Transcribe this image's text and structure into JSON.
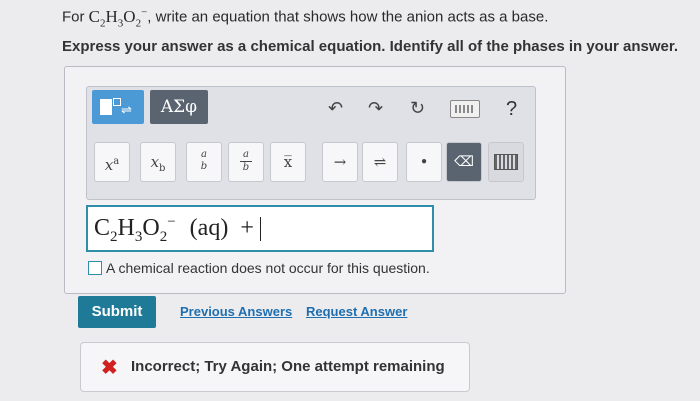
{
  "question": {
    "prefix": "For",
    "formula": {
      "c": "C",
      "c_sub": "2",
      "h": "H",
      "h_sub": "3",
      "o": "O",
      "o_sub": "2",
      "charge": "−"
    },
    "suffix": ", write an equation that shows how the anion acts as a base.",
    "instruction": "Express your answer as a chemical equation. Identify all of the phases in your answer."
  },
  "toolbar": {
    "greek_label": "ΑΣφ",
    "help_label": "?",
    "icons": [
      "templates-icon",
      "greek-letters-icon",
      "undo-icon",
      "redo-icon",
      "reset-icon",
      "keyboard-icon",
      "help-icon"
    ]
  },
  "symbols": [
    {
      "name": "superscript-button",
      "label": "x",
      "sup": "a"
    },
    {
      "name": "subscript-button",
      "label": "x",
      "sub": "b"
    },
    {
      "name": "fraction-button",
      "num": "a",
      "den": "b"
    },
    {
      "name": "fraction-bar-button",
      "num": "a",
      "den": "b"
    },
    {
      "name": "overbar-button",
      "label": "x̅"
    },
    {
      "name": "arrow-button",
      "label": "→"
    },
    {
      "name": "equilibrium-button",
      "label": "⇌"
    },
    {
      "name": "dot-button",
      "label": "•"
    },
    {
      "name": "delete-button",
      "label": "⌫"
    },
    {
      "name": "keyboard-button",
      "label": ""
    }
  ],
  "answer": {
    "c": "C",
    "c_sub": "2",
    "h": "H",
    "h_sub": "3",
    "o": "O",
    "o_sub": "2",
    "charge": "−",
    "phase": "(aq)",
    "plus": "+"
  },
  "no_reaction": {
    "label": "A chemical reaction does not occur for this question.",
    "checked": false
  },
  "actions": {
    "submit_label": "Submit",
    "previous_label": "Previous Answers",
    "request_label": "Request Answer"
  },
  "feedback": {
    "icon": "x-icon",
    "message": "Incorrect; Try Again; One attempt remaining",
    "status_color": "#d02020"
  },
  "colors": {
    "accent": "#1f7a98",
    "link": "#1f6fb0",
    "template_button": "#4b9ad6"
  }
}
